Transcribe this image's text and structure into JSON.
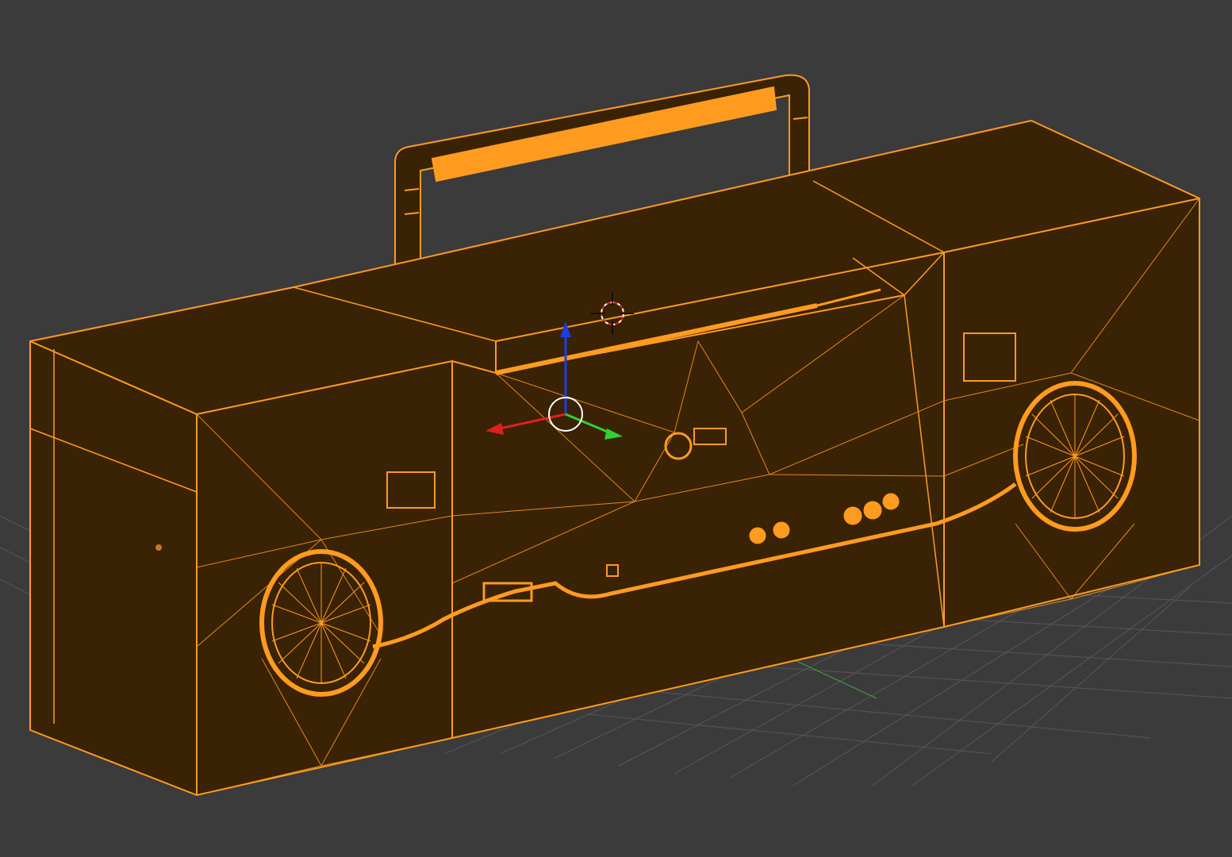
{
  "viewport": {
    "mode": "wireframe-edit",
    "background_color": "#3b3b3b",
    "grid_visible": true,
    "grid_color": "#5a5a5a",
    "object": {
      "name": "",
      "selected": true,
      "wire_color": "#ff9b1f",
      "fill_color": "#3a2204"
    },
    "gizmo": {
      "x_axis_color": "#e0201f",
      "y_axis_color": "#2fd22f",
      "z_axis_color": "#1f3de0"
    },
    "cursor_3d_visible": true
  }
}
